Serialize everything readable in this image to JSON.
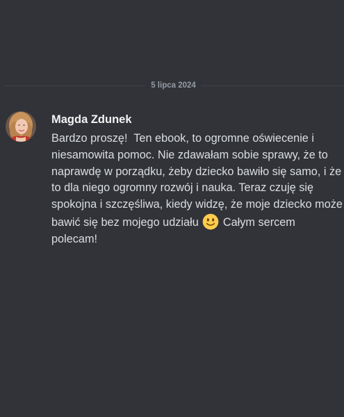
{
  "divider": {
    "date": "5 lipca 2024"
  },
  "message": {
    "author": "Magda Zdunek",
    "content_before_emoji": "Bardzo proszę!  Ten ebook, to ogromne oświecenie i niesamowita pomoc. Nie zdawałam sobie sprawy, że to naprawdę w porządku, żeby dziecko bawiło się samo, i że to dla niego ogromny rozwój i nauka. Teraz czuję się spokojna i szczęśliwa, kiedy widzę, że moje dziecko może bawić się bez mojego udziału ",
    "emoji": "slightly-smiling-face-icon",
    "content_after_emoji": " Całym sercem polecam!"
  },
  "colors": {
    "background": "#313338",
    "divider_line": "#3f4147",
    "date_text": "#949ba4",
    "username": "#f2f3f5",
    "message_text": "#dbdee1",
    "emoji_yellow": "#ffcc4d"
  }
}
